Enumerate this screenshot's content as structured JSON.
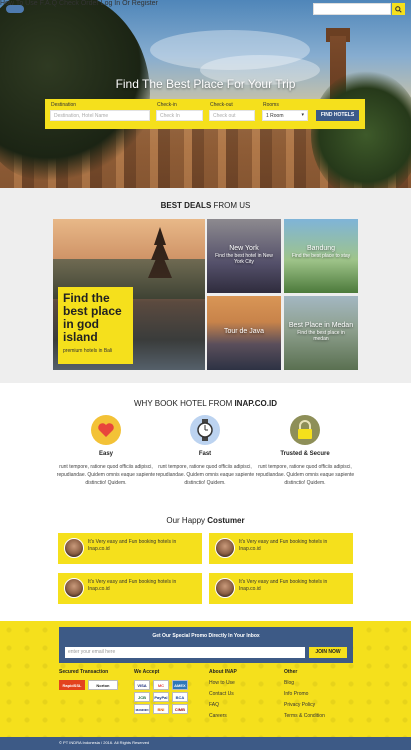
{
  "nav": {
    "items": [
      "How To Use",
      "F.A.Q",
      "Check Order",
      "Log In Or Register"
    ]
  },
  "hero": {
    "title": "Find The Best Place For Your Trip"
  },
  "booking": {
    "destination_label": "Destination",
    "destination_placeholder": "Destination, Hotel Name",
    "checkin_label": "Check-in",
    "checkin_placeholder": "Check In",
    "checkout_label": "Check-out",
    "checkout_placeholder": "Check out",
    "rooms_label": "Rooms",
    "rooms_value": "1 Room",
    "find_button": "FIND HOTELS"
  },
  "deals": {
    "title_normal": "BEST DEALS",
    "title_light": " FROM US",
    "featured": {
      "heading": "Find the best place in god island",
      "sub": "premium hotels in Bali"
    },
    "tiles": [
      {
        "title": "New York",
        "sub": "Find the best hotel in New York City"
      },
      {
        "title": "Bandung",
        "sub": "Find the best place to stay"
      },
      {
        "title": "Tour de Java",
        "sub": ""
      },
      {
        "title": "Best Place in Medan",
        "sub": "Find the best place in medan"
      }
    ]
  },
  "why": {
    "title_light": "WHY BOOK HOTEL FROM ",
    "title_bold": "INAP.CO.ID",
    "features": [
      {
        "name": "Easy",
        "desc": "runt tempore, ratione quod officiis adipisci, repudiandae. Quidem omnis eaque sapiente distinctio! Quidem."
      },
      {
        "name": "Fast",
        "desc": "runt tempore, ratione quod officiis adipisci, repudiandae. Quidem omnis eaque sapiente distinctio! Quidem."
      },
      {
        "name": "Trusted & Secure",
        "desc": "runt tempore, ratione quod officiis adipisci, repudiandae. Quidem omnis eaque sapiente distinctio! Quidem."
      }
    ]
  },
  "testimonials": {
    "title_light": "Our Happy ",
    "title_bold": "Costumer",
    "items": [
      "It's Very easy and Fun booking hotels in Inap.co.id",
      "It's Very easy and Fun booking hotels in Inap.co.id",
      "It's Very easy and Fun booking hotels in Inap.co.id",
      "It's Very easy and Fun booking hotels in Inap.co.id"
    ]
  },
  "promo": {
    "title": "Get Our Special Promo Directly In Your Inbox",
    "placeholder": "enter your email here",
    "button": "JOIN NOW"
  },
  "footer": {
    "secured_title": "Secured Transaction",
    "secured_badges": [
      "RapidSSL",
      "Norton"
    ],
    "accept_title": "We Accept",
    "accept_badges": [
      "VISA",
      "MC",
      "AMEX",
      "JCB",
      "PayPal",
      "BCA",
      "MANDIRI",
      "BNI",
      "CIMB"
    ],
    "about_title": "About INAP",
    "about_links": [
      "How to Use",
      "Contact Us",
      "FAQ",
      "Careers"
    ],
    "other_title": "Other",
    "other_links": [
      "Blog",
      "Info Promo",
      "Privacy Policy",
      "Terms & Condition"
    ],
    "copyright": "© PT INDRA Indonesia / 2016. All Rights Reserved"
  },
  "colors": {
    "accent": "#f5e01c",
    "navy": "#3d5a86"
  }
}
